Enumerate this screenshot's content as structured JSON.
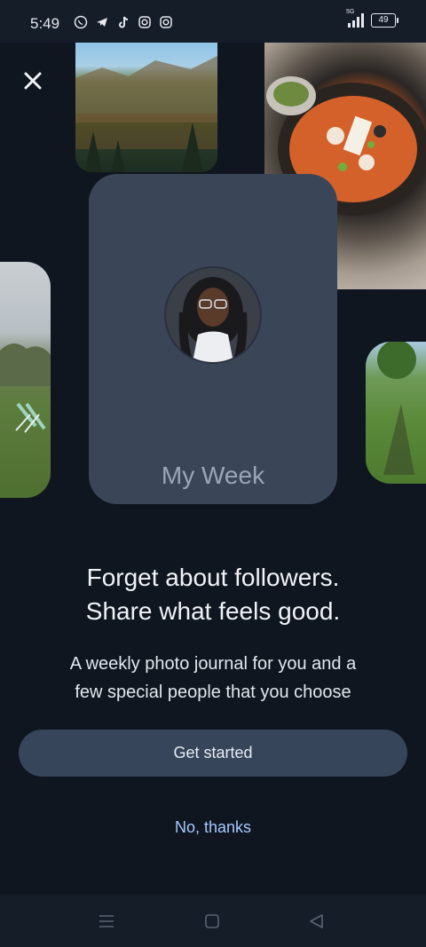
{
  "status_bar": {
    "time": "5:49",
    "network": "5G",
    "battery": "49",
    "icons": [
      "whatsapp-icon",
      "telegram-icon",
      "tiktok-icon",
      "instagram-icon",
      "instagram-icon"
    ]
  },
  "card": {
    "title": "My Week"
  },
  "headline": {
    "line1": "Forget about followers.",
    "line2": "Share what feels good."
  },
  "subtext": {
    "line1": "A weekly photo journal for you and a",
    "line2": "few special people that you choose"
  },
  "buttons": {
    "primary": "Get started",
    "secondary": "No, thanks"
  },
  "colors": {
    "background": "#0f1620",
    "card": "#3a4658",
    "primary_button": "#364559",
    "link": "#a6c8ff"
  }
}
